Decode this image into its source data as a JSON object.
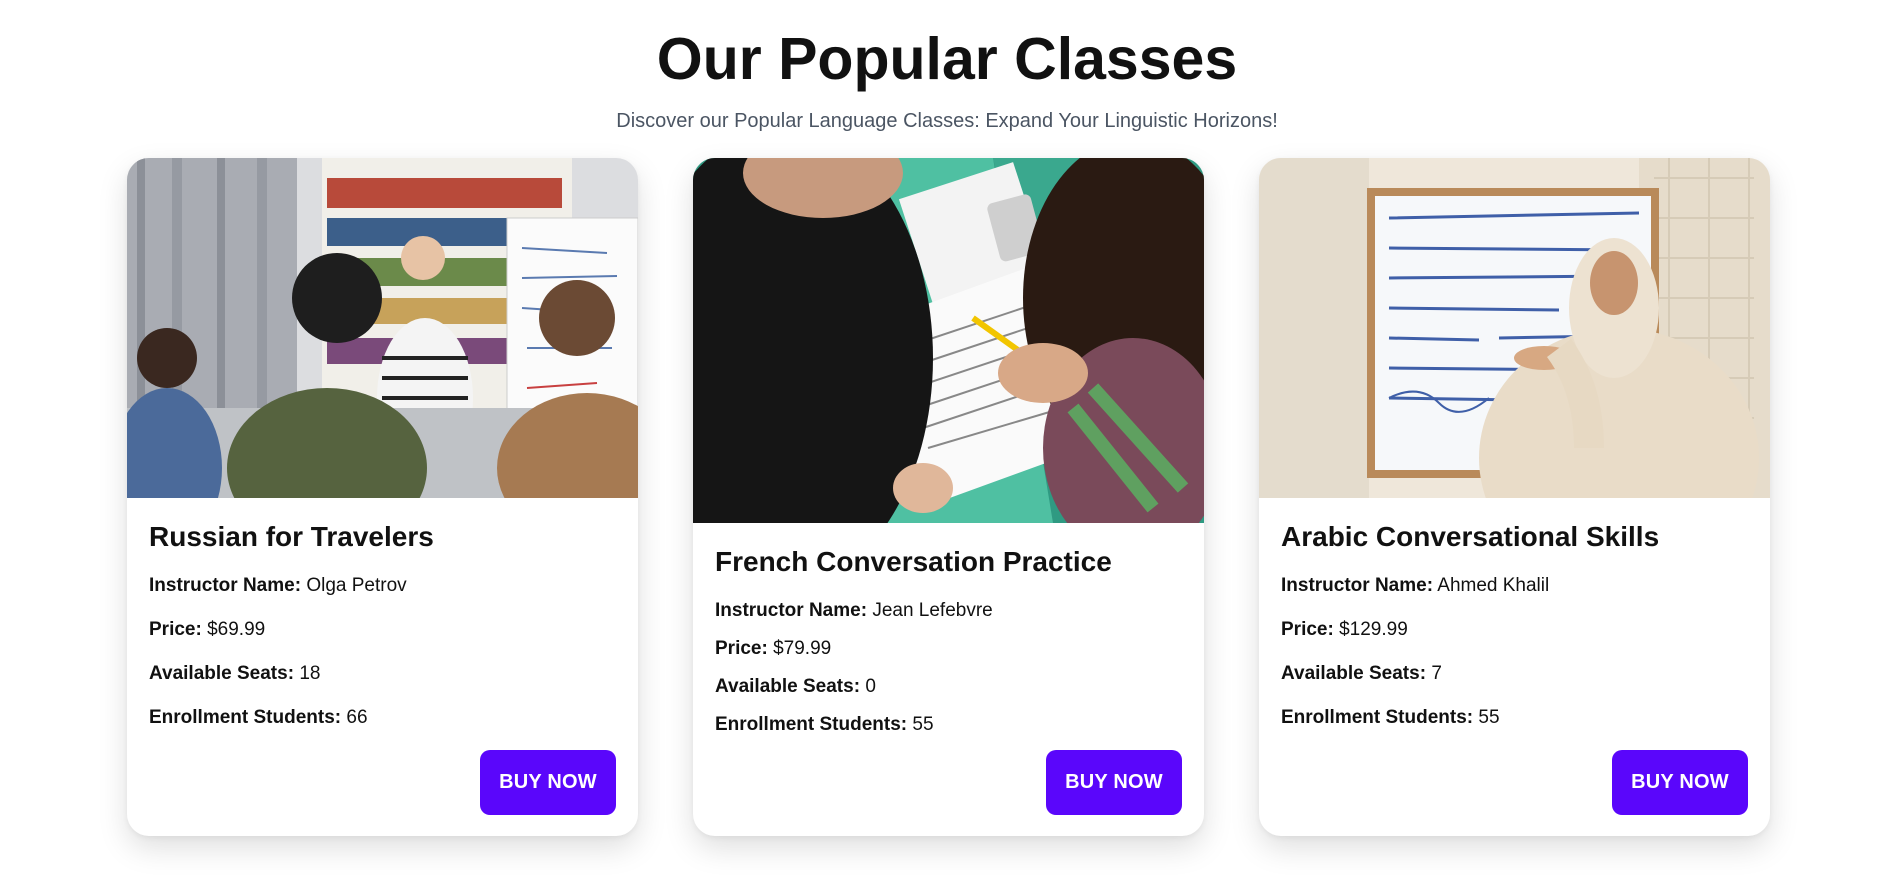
{
  "header": {
    "title": "Our Popular Classes",
    "subtitle": "Discover our Popular Language Classes: Expand Your Linguistic Horizons!"
  },
  "labels": {
    "instructor": "Instructor Name:",
    "price": "Price:",
    "seats": "Available Seats:",
    "enrolled": "Enrollment Students:"
  },
  "classes": [
    {
      "title": "Russian for Travelers",
      "instructor": "Olga Petrov",
      "price": "$69.99",
      "seats": "18",
      "enrolled": "66",
      "button": "BUY NOW"
    },
    {
      "title": "French Conversation Practice",
      "instructor": "Jean Lefebvre",
      "price": "$79.99",
      "seats": "0",
      "enrolled": "55",
      "button": "BUY NOW"
    },
    {
      "title": "Arabic Conversational Skills",
      "instructor": "Ahmed Khalil",
      "price": "$129.99",
      "seats": "7",
      "enrolled": "55",
      "button": "BUY NOW"
    }
  ],
  "colors": {
    "accent": "#5a06fb",
    "subtitle": "#4b5563"
  }
}
